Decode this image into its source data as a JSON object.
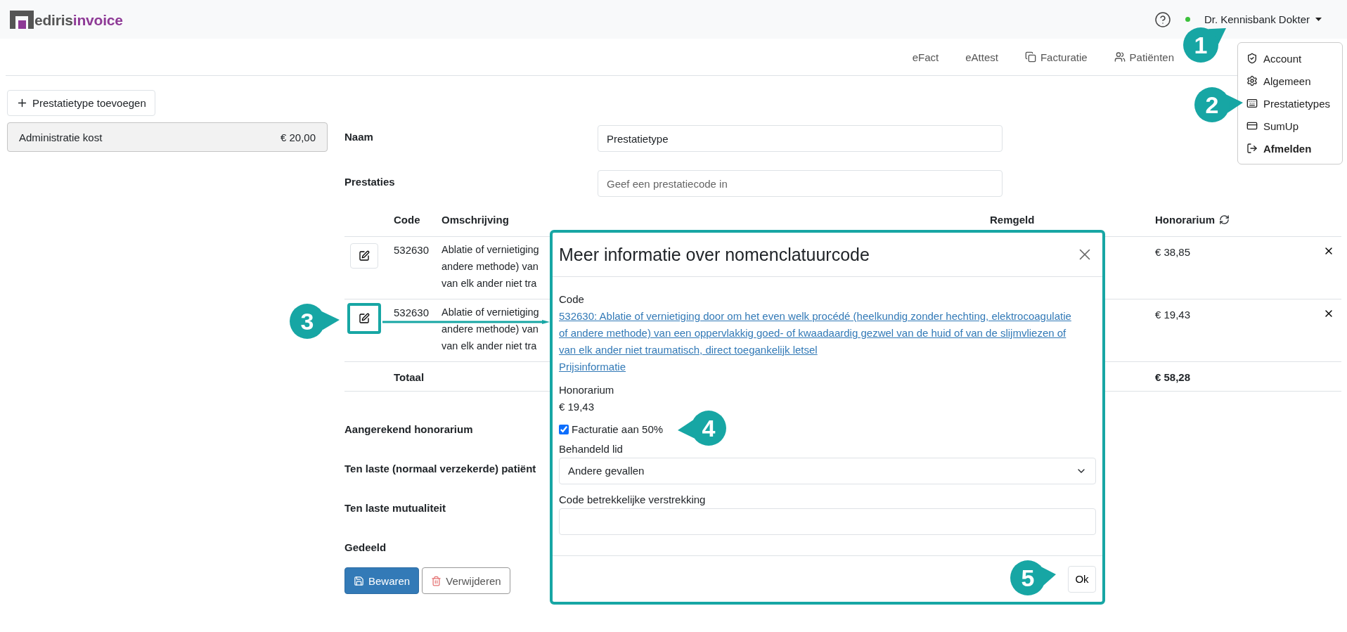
{
  "header": {
    "logo": {
      "brand": "ediris",
      "product": "invoice"
    },
    "online": true,
    "user": "Dr. Kennisbank Dokter"
  },
  "nav": [
    {
      "label": "eFact"
    },
    {
      "label": "eAttest"
    },
    {
      "label": "Facturatie"
    },
    {
      "label": "Patiënten"
    }
  ],
  "user_menu": {
    "open": true,
    "items": [
      {
        "label": "Account",
        "bold": false
      },
      {
        "label": "Algemeen",
        "bold": false
      },
      {
        "label": "Prestatietypes",
        "bold": false
      },
      {
        "label": "SumUp",
        "bold": false
      },
      {
        "label": "Afmelden",
        "bold": true
      }
    ]
  },
  "sidebar": {
    "add_button": "Prestatietype toevoegen",
    "items": [
      {
        "name": "Administratie kost",
        "amount": "€ 20,00",
        "selected": true
      }
    ]
  },
  "form": {
    "fields": [
      {
        "label": "Naam",
        "value": "Prestatietype"
      },
      {
        "label": "Prestaties",
        "placeholder": "Geef een prestatiecode in"
      }
    ]
  },
  "table": {
    "columns": [
      "Code",
      "Omschrijving",
      "Remgeld",
      "Honorarium"
    ],
    "rows": [
      {
        "code": "532630",
        "description_lines": [
          "Ablatie of vernietiging",
          "andere methode) van",
          "van elk ander niet tra"
        ],
        "honorarium": "€ 38,85",
        "highlighted": false
      },
      {
        "code": "532630",
        "description_lines": [
          "Ablatie of vernietiging",
          "andere methode) van",
          "van elk ander niet tra"
        ],
        "honorarium": "€ 19,43",
        "highlighted": true
      }
    ],
    "total": {
      "label": "Totaal",
      "honorarium": "€ 58,28"
    }
  },
  "summary": [
    "Aangerekend honorarium",
    "Ten laste (normaal verzekerde) patiënt",
    "Ten laste mutualiteit",
    "Gedeeld"
  ],
  "actions": [
    {
      "label": "Bewaren",
      "kind": "primary"
    },
    {
      "label": "Verwijderen",
      "kind": "danger"
    }
  ],
  "modal": {
    "title": "Meer informatie over nomenclatuurcode",
    "code_label": "Code",
    "code_link": "532630: Ablatie of vernietiging door om het even welk procédé (heelkundig zonder hechting, elektrocoagulatie of andere methode) van een oppervlakkig goed- of kwaadaardig gezwel van de huid of van de slijmvliezen of van elk ander niet traumatisch, direct toegankelijk letsel",
    "price_link": "Prijsinformatie",
    "honorarium_label": "Honorarium",
    "honorarium_value": "€ 19,43",
    "checkbox": {
      "label": "Facturatie aan 50%",
      "checked": true
    },
    "select": {
      "label": "Behandeld lid",
      "value": "Andere gevallen"
    },
    "input": {
      "label": "Code betrekkelijke verstrekking"
    },
    "ok": "Ok"
  },
  "annotations": [
    {
      "label": "1"
    },
    {
      "label": "2"
    },
    {
      "label": "3"
    },
    {
      "label": "4"
    },
    {
      "label": "5"
    }
  ]
}
